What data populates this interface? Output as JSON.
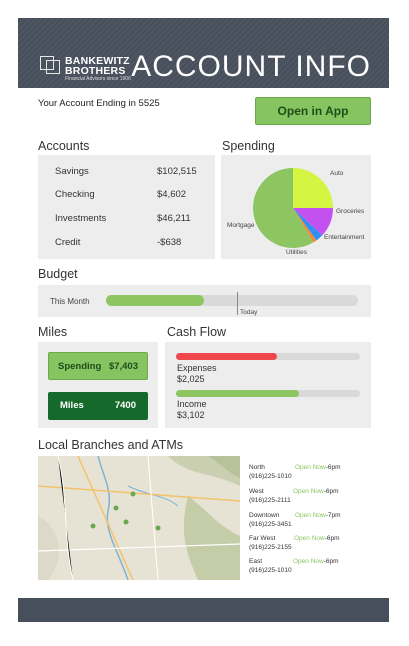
{
  "header": {
    "brand_line1": "BANKEWITZ",
    "brand_line2": "BROTHERS",
    "brand_tagline": "Financial Advisors since 1906",
    "title": "ACCOUNT INFO",
    "bg_color": "#474f5c"
  },
  "account": {
    "ending_text": "Your Account Ending in 5525",
    "open_app_label": "Open in App"
  },
  "accounts": {
    "title": "Accounts",
    "items": [
      {
        "name": "Savings",
        "value": "$102,515"
      },
      {
        "name": "Checking",
        "value": "$4,602"
      },
      {
        "name": "Investments",
        "value": "$46,211"
      },
      {
        "name": "Credit",
        "value": "-$638"
      }
    ]
  },
  "spending": {
    "title": "Spending",
    "slices": [
      {
        "label": "Auto",
        "percent": 25,
        "color": "#d4f542"
      },
      {
        "label": "Groceries",
        "percent": 12,
        "color": "#c251f0"
      },
      {
        "label": "Entertainment",
        "percent": 3,
        "color": "#2f8ff2"
      },
      {
        "label": "Utilities",
        "percent": 1.5,
        "color": "#f08a3a"
      },
      {
        "label": "Mortgage",
        "percent": 58.5,
        "color": "#8cc562"
      }
    ]
  },
  "budget": {
    "title": "Budget",
    "label": "This Month",
    "progress": 0.39,
    "today_label": "Today",
    "today_position": 0.52
  },
  "miles": {
    "title": "Miles",
    "spending_label": "Spending",
    "spending_value": "$7,403",
    "miles_label": "Miles",
    "miles_value": "7400"
  },
  "cashflow": {
    "title": "Cash Flow",
    "expenses_label": "Expenses",
    "expenses_value": "$2,025",
    "expenses_fraction": 0.55,
    "income_label": "Income",
    "income_value": "$3,102",
    "income_fraction": 0.67,
    "expenses_color": "#f0474c",
    "income_color": "#8cc562"
  },
  "branches": {
    "title": "Local Branches and ATMs",
    "items": [
      {
        "name": "North",
        "status": "Open Now",
        "hours": "-6pm",
        "phone": "(916)225-1010"
      },
      {
        "name": "West",
        "status": "Open Now",
        "hours": "-6pm",
        "phone": "(916)225-2111"
      },
      {
        "name": "Downtown",
        "status": "Open Now",
        "hours": "-7pm",
        "phone": "(916)225-3451"
      },
      {
        "name": "Far West",
        "status": "Open Now",
        "hours": "-6pm",
        "phone": "(916)225-2155"
      },
      {
        "name": "East",
        "status": "Open Now",
        "hours": "-6pm",
        "phone": "(916)225-1010"
      }
    ]
  }
}
